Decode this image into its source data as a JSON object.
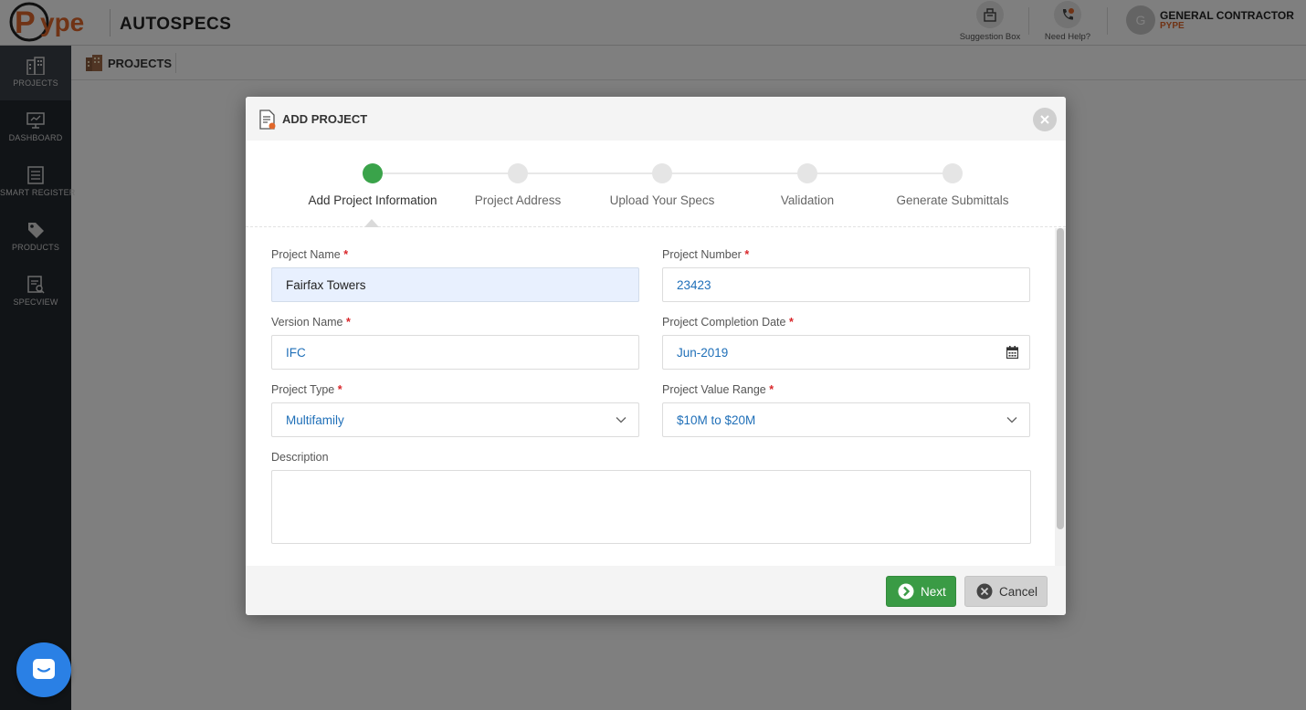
{
  "app": {
    "name": "AUTOSPECS",
    "logo_text": "Pype"
  },
  "topbar": {
    "suggestion_label": "Suggestion Box",
    "help_label": "Need Help?",
    "user_initial": "G",
    "user_role": "GENERAL CONTRACTOR",
    "user_org": "PYPE"
  },
  "sidebar": {
    "items": [
      {
        "label": "PROJECTS",
        "icon": "building-icon",
        "active": true
      },
      {
        "label": "DASHBOARD",
        "icon": "monitor-icon",
        "active": false
      },
      {
        "label": "SMART REGISTER",
        "icon": "register-icon",
        "active": false
      },
      {
        "label": "PRODUCTS",
        "icon": "tag-icon",
        "active": false
      },
      {
        "label": "SPECVIEW",
        "icon": "specview-icon",
        "active": false
      }
    ]
  },
  "breadcrumb": {
    "label": "PROJECTS"
  },
  "modal": {
    "title": "ADD PROJECT",
    "steps": [
      {
        "label": "Add Project Information",
        "active": true
      },
      {
        "label": "Project Address",
        "active": false
      },
      {
        "label": "Upload Your Specs",
        "active": false
      },
      {
        "label": "Validation",
        "active": false
      },
      {
        "label": "Generate Submittals",
        "active": false
      }
    ],
    "form": {
      "required_marker": "*",
      "project_name": {
        "label": "Project Name",
        "value": "Fairfax Towers"
      },
      "project_number": {
        "label": "Project Number",
        "value": "23423"
      },
      "version_name": {
        "label": "Version Name",
        "value": "IFC"
      },
      "completion_date": {
        "label": "Project Completion Date",
        "value": "Jun-2019"
      },
      "project_type": {
        "label": "Project Type",
        "value": "Multifamily"
      },
      "value_range": {
        "label": "Project Value Range",
        "value": "$10M to $20M"
      },
      "description": {
        "label": "Description",
        "value": ""
      }
    },
    "buttons": {
      "next": "Next",
      "cancel": "Cancel"
    }
  },
  "colors": {
    "sidebar_bg": "#23282f",
    "active_step": "#3aa34a",
    "next_button": "#3a9b45",
    "required": "#d9262a",
    "brand_orange": "#e0672a",
    "chat_bubble": "#2a80e5"
  }
}
